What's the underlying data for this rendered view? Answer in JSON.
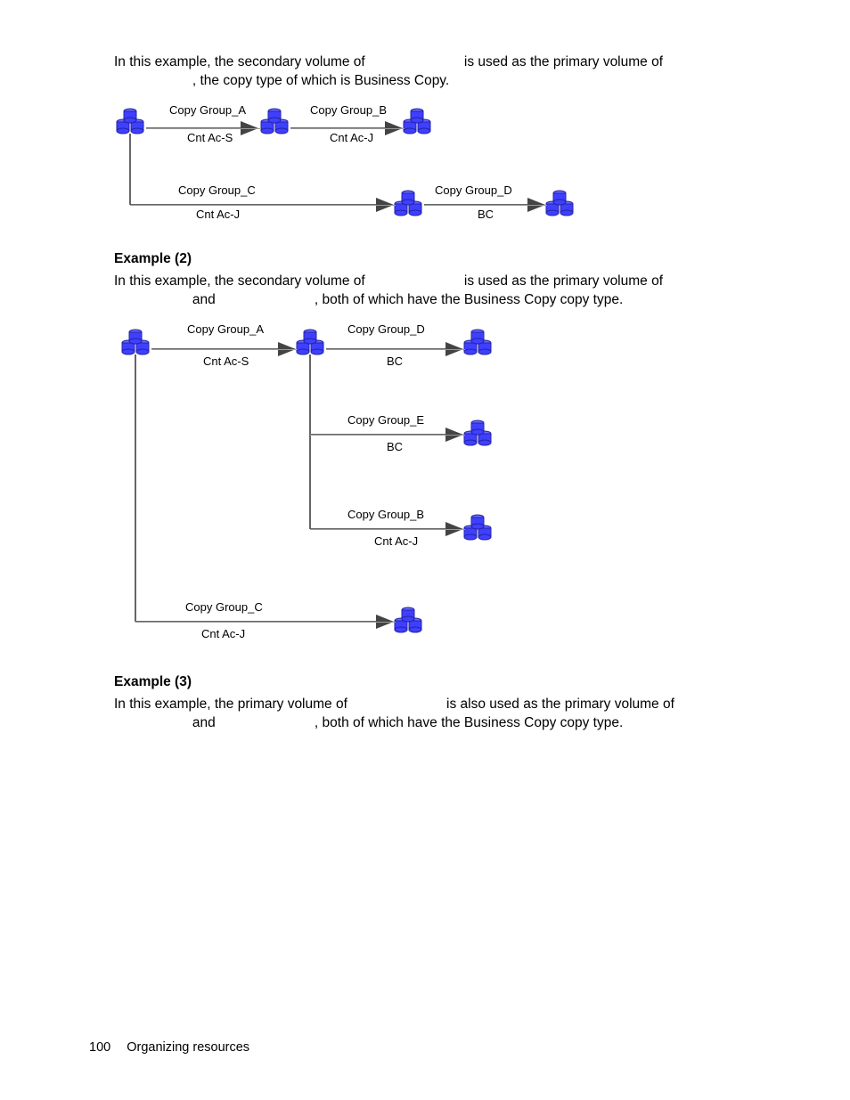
{
  "intro1_a": "In this example, the secondary volume of ",
  "intro1_b": " is used as the primary volume of ",
  "intro1_c": ", the copy type of which is Business Copy.",
  "ex2_h": "Example (2)",
  "ex2_a": "In this example, the secondary volume of ",
  "ex2_b": " is used as the primary volume of ",
  "ex2_c": " and ",
  "ex2_d": ", both of which have the Business Copy copy type.",
  "ex3_h": "Example (3)",
  "ex3_a": "In this example, the primary volume of ",
  "ex3_b": " is also used as the primary volume of ",
  "ex3_c": " and ",
  "ex3_d": ", both of which have the Business Copy copy type.",
  "page_no": "100",
  "section": "Organizing resources",
  "d1": {
    "cgA": "Copy Group_A",
    "cgA_sub": "Cnt Ac-S",
    "cgB": "Copy Group_B",
    "cgB_sub": "Cnt Ac-J",
    "cgC": "Copy Group_C",
    "cgC_sub": "Cnt Ac-J",
    "cgD": "Copy Group_D",
    "cgD_sub": "BC"
  },
  "d2": {
    "cgA": "Copy Group_A",
    "cgA_sub": "Cnt Ac-S",
    "cgD": "Copy Group_D",
    "cgD_sub": "BC",
    "cgE": "Copy Group_E",
    "cgE_sub": "BC",
    "cgB": "Copy Group_B",
    "cgB_sub": "Cnt Ac-J",
    "cgC": "Copy Group_C",
    "cgC_sub": "Cnt Ac-J"
  }
}
